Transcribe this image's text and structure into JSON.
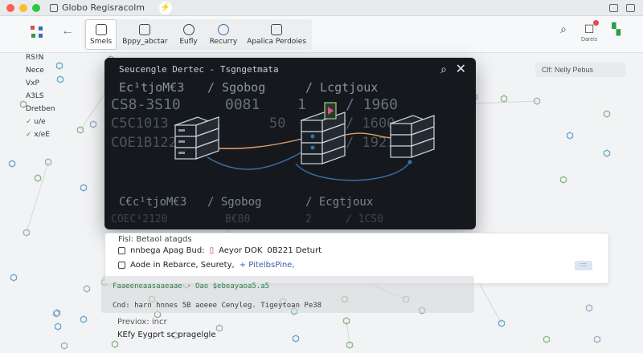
{
  "window": {
    "title": "Globo Regisracolm"
  },
  "toolbar": {
    "tools": [
      {
        "label": "Smels",
        "active": true
      },
      {
        "label": "Bppy_abctar",
        "active": false
      },
      {
        "label": "Eufly",
        "active": false
      },
      {
        "label": "Recurry",
        "active": false
      },
      {
        "label": "Apalica Perdoies",
        "active": false
      }
    ],
    "right_icons": [
      {
        "icon": "search-icon",
        "label": ""
      },
      {
        "icon": "notification-icon",
        "label": "Dareis"
      },
      {
        "icon": "grid-icon",
        "label": ""
      }
    ]
  },
  "sidebar": {
    "items": [
      {
        "label": "RS!N",
        "checked": false
      },
      {
        "label": "Nece",
        "checked": false
      },
      {
        "label": "VxP",
        "checked": false
      },
      {
        "label": "A3LS",
        "checked": false
      },
      {
        "label": "Dretben",
        "checked": false
      },
      {
        "label": "u/e",
        "checked": true
      },
      {
        "label": "x/eE",
        "checked": true
      }
    ]
  },
  "float_button": {
    "label": "Clf: Nelly Pebus"
  },
  "modal": {
    "title": "Seucengle Dertec - Tsgngetmata",
    "rows": [
      [
        "Ec¹tjoM€3",
        "/ Sgobog",
        "/ Lcgtjoux"
      ],
      [
        "CS8-3S10",
        "0081",
        "1",
        "/ 1960"
      ],
      [
        "C5C1013",
        "50",
        "3",
        "/ 1600"
      ],
      [
        "COE1B1220",
        "1",
        "",
        "/ 19210"
      ],
      [
        "C€c¹tjoM€3",
        "/ Sgobog",
        "/ Ecgtjoux"
      ],
      [
        "COEC¹2120",
        "B€80",
        "2",
        "/ 1CS0"
      ]
    ]
  },
  "info": {
    "header": "Fisl: Betaol atagds",
    "line1_a": "nnbega Apag Bud:",
    "line1_b": "Aeyor DOK",
    "line1_c": "0B221 Deturt",
    "line2_a": "Aode in Rebarce, Seurety,",
    "line2_b": "+ PitelbsPine,",
    "chip": "::::"
  },
  "lower": {
    "row1": "Faaeeneaasaaeaae · Oao $ebeayaoa5.a5",
    "row2": "Cnd: harn hnnes  5B  aoeee Cenyleg. Tigeytoan Pe38",
    "row3": "Previox: incr",
    "row4": "KEfy Eygprt sc  pragelgle"
  },
  "colors": {
    "modal_bg": "#15191e",
    "accent": "#3a6fb0",
    "link_orange": "#e6a06a"
  }
}
